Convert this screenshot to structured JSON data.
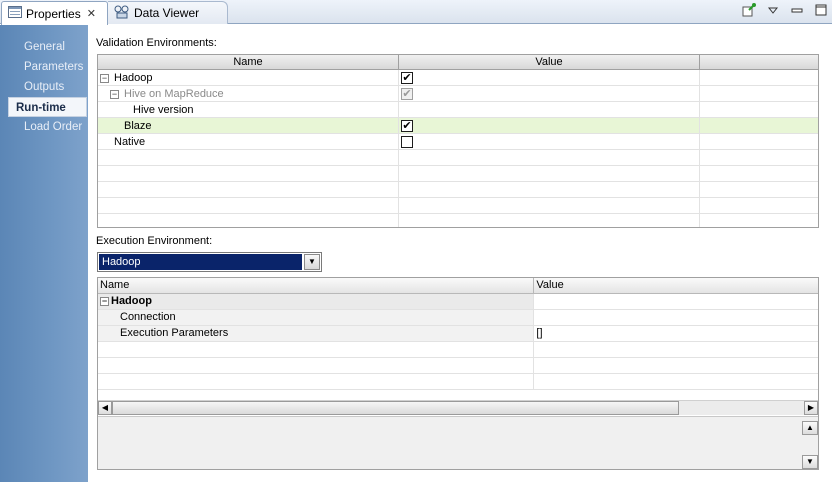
{
  "tabs": [
    {
      "label": "Properties",
      "icon": "properties-icon",
      "closable": true
    },
    {
      "label": "Data Viewer",
      "icon": "data-viewer-icon"
    }
  ],
  "sidebar": {
    "items": [
      {
        "label": "General"
      },
      {
        "label": "Parameters"
      },
      {
        "label": "Outputs"
      },
      {
        "label": "Run-time",
        "active": true
      },
      {
        "label": "Load Order"
      }
    ]
  },
  "validation": {
    "label": "Validation Environments:",
    "columns": [
      "Name",
      "Value"
    ],
    "rows": [
      {
        "name": "Hadoop",
        "checked": true
      },
      {
        "name": "Hive on MapReduce",
        "checked": true,
        "disabled": true
      },
      {
        "name": "Hive version"
      },
      {
        "name": "Blaze",
        "checked": true,
        "selected": true
      },
      {
        "name": "Native",
        "checked": false
      }
    ]
  },
  "execution": {
    "label": "Execution Environment:",
    "selected": "Hadoop",
    "columns": [
      "Name",
      "Value"
    ],
    "group": "Hadoop",
    "rows": [
      {
        "name": "Connection",
        "value": ""
      },
      {
        "name": "Execution Parameters",
        "value": "[]"
      }
    ]
  },
  "colors": {
    "sidebar": "#6f97c3",
    "selected_row": "#e8f6d6",
    "dropdown_highlight": "#0a246a"
  }
}
